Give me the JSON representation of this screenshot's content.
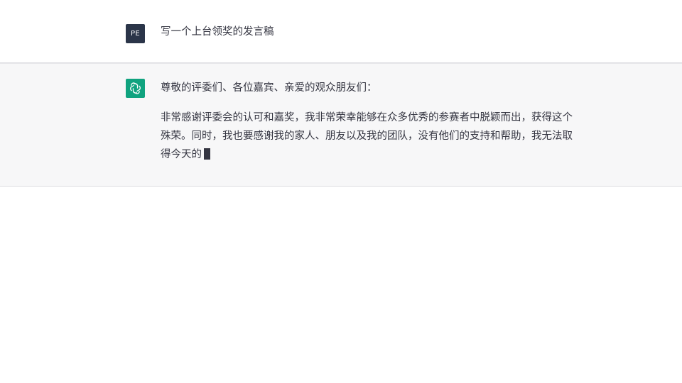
{
  "conversation": {
    "user": {
      "avatar_text": "PE",
      "message": "写一个上台领奖的发言稿"
    },
    "assistant": {
      "avatar_icon": "openai-logo-icon",
      "paragraph_1": "尊敬的评委们、各位嘉宾、亲爱的观众朋友们：",
      "paragraph_2": "非常感谢评委会的认可和嘉奖，我非常荣幸能够在众多优秀的参赛者中脱颖而出，获得这个殊荣。同时，我也要感谢我的家人、朋友以及我的团队，没有他们的支持和帮助，我无法取得今天的"
    }
  },
  "colors": {
    "user_avatar_bg": "#2b3549",
    "assistant_avatar_bg": "#10a37f",
    "assistant_row_bg": "#f7f7f8",
    "text": "#343541"
  }
}
